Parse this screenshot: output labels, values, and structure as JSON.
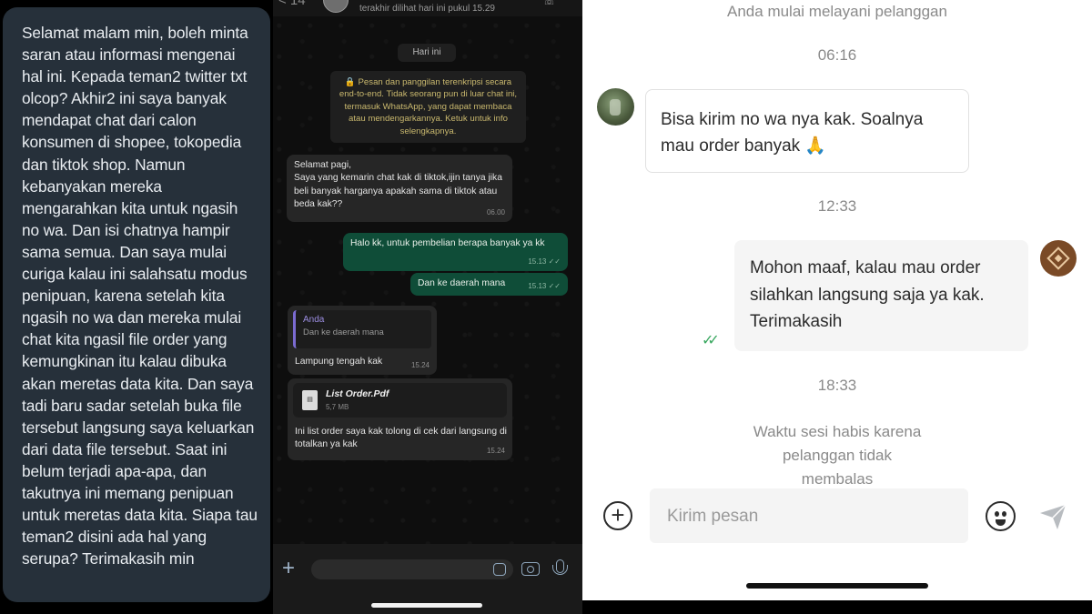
{
  "tweet": {
    "text": "Selamat malam min, boleh minta saran atau informasi mengenai hal ini. Kepada teman2 twitter txt olcop? Akhir2 ini saya banyak mendapat chat dari calon konsumen di shopee, tokopedia dan tiktok shop. Namun kebanyakan mereka mengarahkan kita untuk ngasih no wa. Dan isi chatnya hampir sama semua. Dan saya mulai curiga kalau ini salahsatu modus penipuan, karena setelah kita ngasih no wa dan mereka mulai chat kita ngasil file order yang kemungkinan itu kalau dibuka akan meretas data kita. Dan saya tadi baru sadar setelah buka file tersebut langsung saya keluarkan dari data file tersebut. Saat ini belum terjadi apa-apa, dan takutnya ini memang penipuan untuk meretas data kita. Siapa tau teman2 disini ada hal yang serupa? Terimakasih min"
  },
  "whatsapp": {
    "header": {
      "back_count": "< 14",
      "last_seen": "terakhir dilihat hari ini pukul 15.29"
    },
    "date_label": "Hari ini",
    "encryption_notice": "🔒 Pesan dan panggilan terenkripsi secara end-to-end. Tidak seorang pun di luar chat ini, termasuk WhatsApp, yang dapat membaca atau mendengarkannya. Ketuk untuk info selengkapnya.",
    "messages": [
      {
        "direction": "in",
        "text": "Selamat pagi,\nSaya yang kemarin chat kak di tiktok,ijin tanya jika beli banyak harganya apakah sama di tiktok atau beda kak??",
        "time": "06.00"
      },
      {
        "direction": "out",
        "text": "Halo kk, untuk pembelian berapa banyak ya kk",
        "time": "15.13 ✓✓"
      },
      {
        "direction": "out",
        "text": "Dan ke daerah mana",
        "time": "15.13 ✓✓"
      },
      {
        "direction": "in",
        "quote_author": "Anda",
        "quote_text": "Dan ke daerah mana",
        "text": "Lampung tengah kak",
        "time": "15.24"
      },
      {
        "direction": "in",
        "file_name": "List Order.Pdf",
        "file_size": "5,7 MB",
        "text": "Ini list order saya kak tolong di cek dari langsung di totalkan ya kak",
        "time": "15.24"
      }
    ],
    "colors": {
      "incoming": "#262626",
      "outgoing": "#0f4d38",
      "background": "#0e0e0e"
    }
  },
  "shopee": {
    "session_started": "Anda mulai melayani pelanggan",
    "time_1": "06:16",
    "customer_message": "Bisa kirim no wa nya kak. Soalnya mau order banyak 🙏",
    "time_2": "12:33",
    "seller_message": "Mohon maaf, kalau mau order silahkan langsung saja ya kak. Terimakasih",
    "read_marks": "✓✓",
    "time_3": "18:33",
    "session_ended": "Waktu sesi habis karena pelanggan tidak membalas",
    "composer_placeholder": "Kirim pesan",
    "colors": {
      "seller_bubble": "#f5f5f5",
      "read_check": "#3aa860"
    }
  }
}
